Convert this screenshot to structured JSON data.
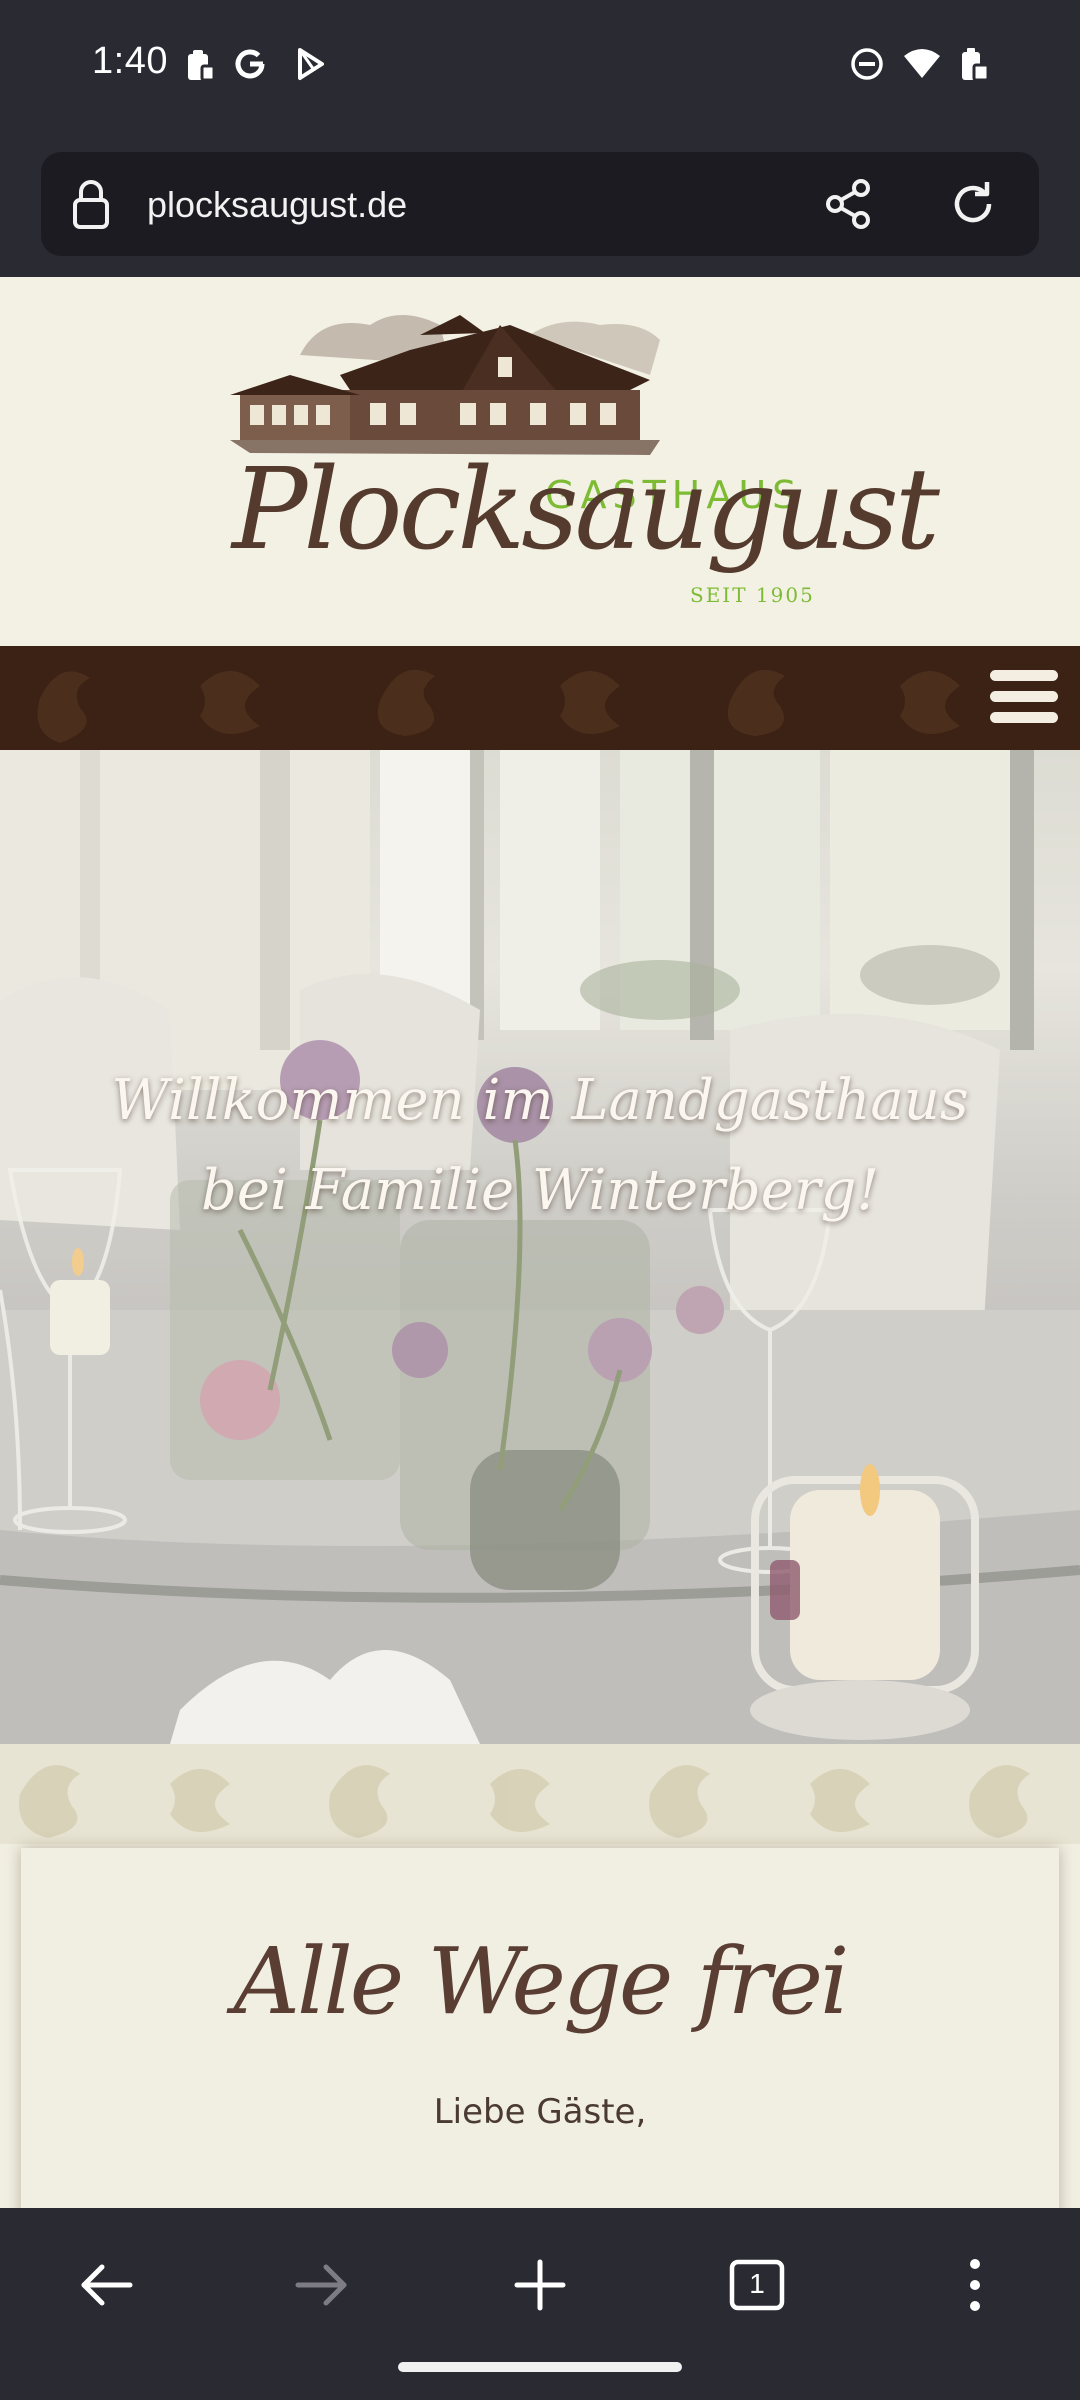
{
  "status_bar": {
    "time": "1:40",
    "left_icons": [
      "clipboard-icon",
      "google-icon",
      "play-store-icon"
    ],
    "right_icons": [
      "do-not-disturb-icon",
      "wifi-icon",
      "battery-icon"
    ]
  },
  "browser": {
    "url": "plocksaugust.de",
    "toolbar": [
      "back-icon",
      "forward-icon",
      "new-tab-icon",
      "tabs-icon",
      "menu-icon"
    ],
    "tab_count": "1"
  },
  "site": {
    "logo": {
      "subtitle": "GASTHAUS",
      "name": "Plocksaugust",
      "since": "SEIT 1905"
    },
    "hero": {
      "line1": "Willkommen im Landgasthaus",
      "line2": "bei Familie Winterberg!"
    },
    "card": {
      "title": "Alle Wege frei",
      "greeting": "Liebe Gäste,"
    }
  },
  "colors": {
    "browser_chrome": "#2a2a33",
    "url_pill": "#1c1b22",
    "site_background": "#f1efe2",
    "logo_green": "#7dbb35",
    "logo_brown": "#553a2e",
    "nav_brown": "#3b2214"
  }
}
